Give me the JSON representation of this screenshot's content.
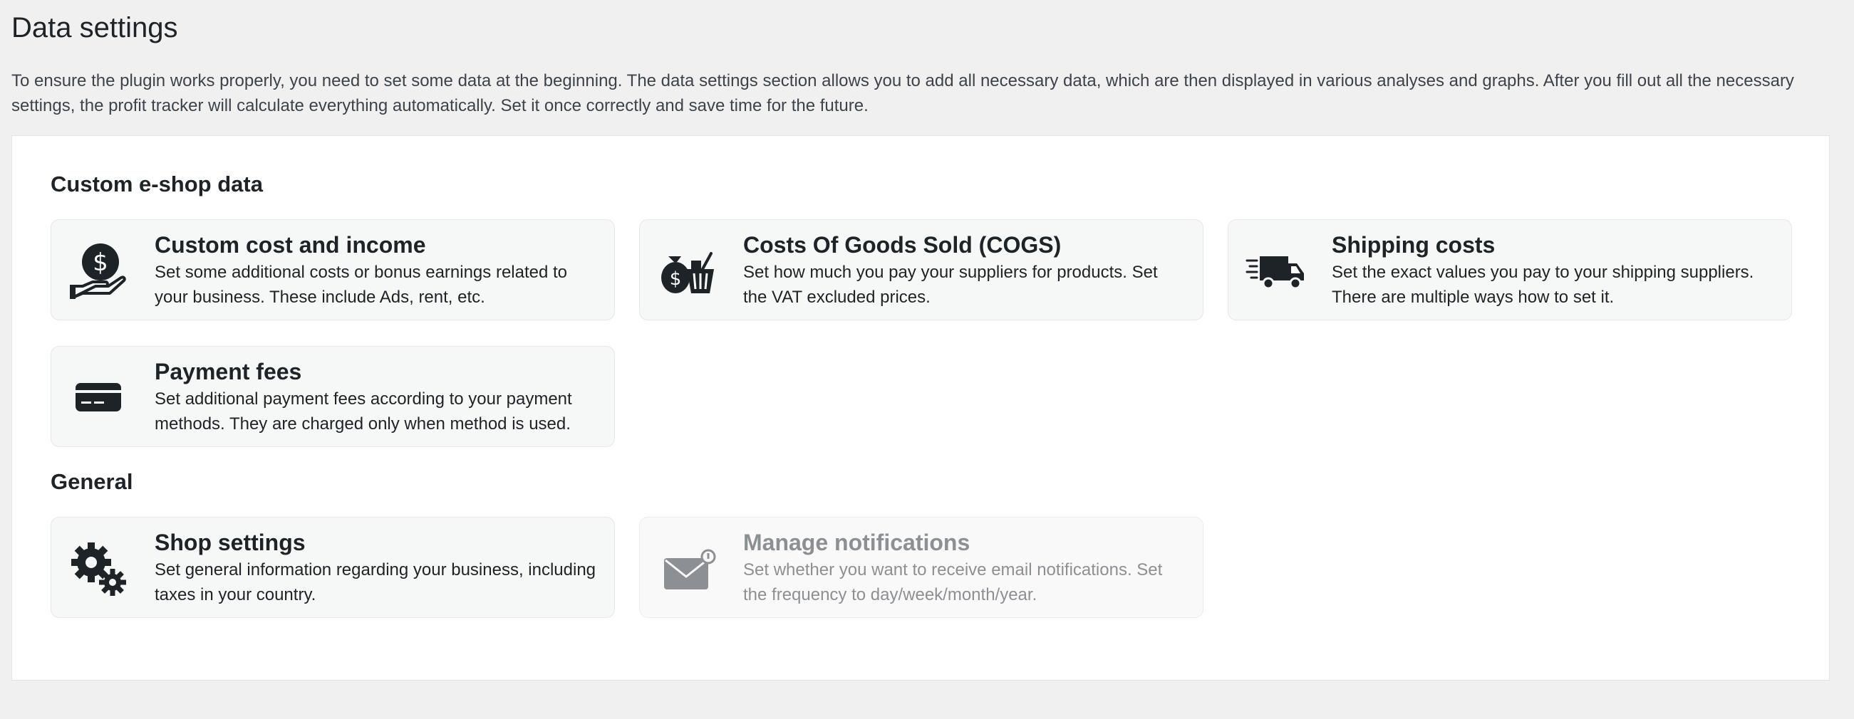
{
  "page": {
    "title": "Data settings",
    "intro": "To ensure the plugin works properly, you need to set some data at the beginning. The data settings section allows you to add all necessary data, which are then displayed in various analyses and graphs. After you fill out all the necessary settings, the profit tracker will calculate everything automatically. Set it once correctly and save time for the future."
  },
  "sections": {
    "custom": {
      "title": "Custom e-shop data",
      "cards": [
        {
          "icon": "dollar-hand-icon",
          "title": "Custom cost and income",
          "description": "Set some additional costs or bonus earnings related to your business. These include Ads, rent, etc."
        },
        {
          "icon": "money-basket-icon",
          "title": "Costs Of Goods Sold (COGS)",
          "description": "Set how much you pay your suppliers for products. Set the VAT excluded prices."
        },
        {
          "icon": "delivery-truck-icon",
          "title": "Shipping costs",
          "description": "Set the exact values you pay to your shipping suppliers. There are multiple ways how to set it."
        },
        {
          "icon": "credit-card-icon",
          "title": "Payment fees",
          "description": "Set additional payment fees according to your payment methods. They are charged only when method is used."
        }
      ]
    },
    "general": {
      "title": "General",
      "cards": [
        {
          "icon": "gears-icon",
          "title": "Shop settings",
          "description": "Set general information regarding your business, including taxes in your country."
        },
        {
          "icon": "envelope-notification-icon",
          "title": "Manage notifications",
          "description": "Set whether you want to receive email notifications. Set the frequency to day/week/month/year.",
          "disabled": true
        }
      ]
    }
  },
  "colors": {
    "background": "#f0f0f1",
    "panel": "#ffffff",
    "card": "#f6f7f7",
    "text": "#1d2327",
    "disabled_text": "#8c8f94"
  }
}
